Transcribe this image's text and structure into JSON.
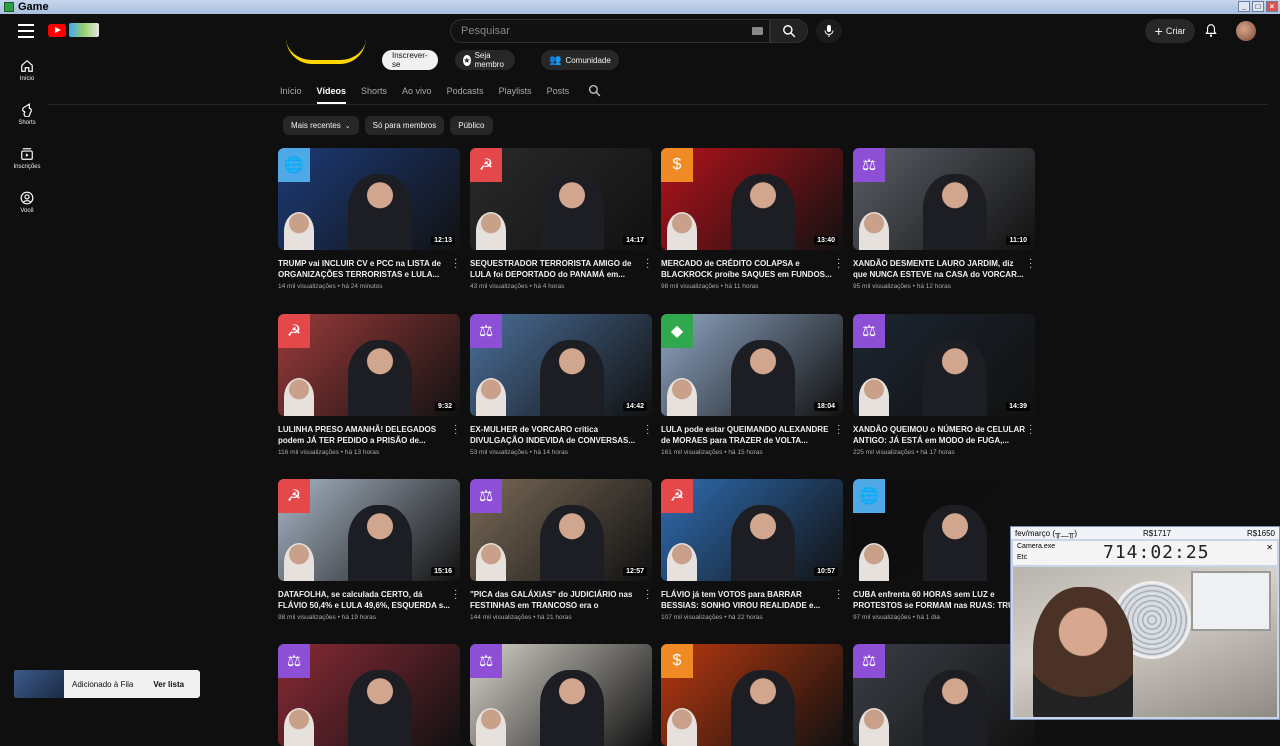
{
  "window": {
    "title": "Game"
  },
  "topbar": {
    "search_placeholder": "Pesquisar",
    "create_label": "Criar"
  },
  "sidebar": {
    "items": [
      {
        "label": "Início",
        "icon": "home-icon"
      },
      {
        "label": "Shorts",
        "icon": "shorts-icon"
      },
      {
        "label": "Inscrições",
        "icon": "subscriptions-icon"
      },
      {
        "label": "Você",
        "icon": "you-icon"
      }
    ]
  },
  "channel": {
    "subscribe_label": "Inscrever-se",
    "member_label": "Seja membro",
    "community_label": "Comunidade"
  },
  "tabs": [
    {
      "label": "Início",
      "active": false
    },
    {
      "label": "Vídeos",
      "active": true
    },
    {
      "label": "Shorts",
      "active": false
    },
    {
      "label": "Ao vivo",
      "active": false
    },
    {
      "label": "Podcasts",
      "active": false
    },
    {
      "label": "Playlists",
      "active": false
    },
    {
      "label": "Posts",
      "active": false
    }
  ],
  "chips": [
    {
      "label": "Mais recentes"
    },
    {
      "label": "Só para membros"
    },
    {
      "label": "Público"
    }
  ],
  "videos": [
    {
      "title": "TRUMP vai INCLUIR CV e PCC na LISTA de ORGANIZAÇÕES TERRORISTAS e LULA...",
      "views": "14 mil visualizações",
      "age": "há 24 minutos",
      "duration": "12:13",
      "badge": "globe",
      "badge_color": "#4fa9e6",
      "bg": "#1d3b78"
    },
    {
      "title": "SEQUESTRADOR TERRORISTA AMIGO de LULA foi DEPORTADO do PANAMÁ em...",
      "views": "43 mil visualizações",
      "age": "há 4 horas",
      "duration": "14:17",
      "badge": "hammer-sickle",
      "badge_color": "#e4484b",
      "bg": "#2a2a2a"
    },
    {
      "title": "MERCADO de CRÉDITO COLAPSA e BLACKROCK proíbe SAQUES em FUNDOS...",
      "views": "98 mil visualizações",
      "age": "há 11 horas",
      "duration": "13:40",
      "badge": "dollar",
      "badge_color": "#f08a24",
      "bg": "#b3121b"
    },
    {
      "title": "XANDÃO DESMENTE LAURO JARDIM, diz que NUNCA ESTEVE na CASA do VORCAR...",
      "views": "95 mil visualizações",
      "age": "há 12 horas",
      "duration": "11:10",
      "badge": "scales",
      "badge_color": "#8c4fd6",
      "bg": "#5a5f66"
    },
    {
      "title": "LULINHA PRESO AMANHÃ! DELEGADOS podem JÁ TER PEDIDO a PRISÃO de...",
      "views": "116 mil visualizações",
      "age": "há 13 horas",
      "duration": "9:32",
      "badge": "hammer-sickle",
      "badge_color": "#e4484b",
      "bg": "#9b3a3a"
    },
    {
      "title": "EX-MULHER de VORCARO critica DIVULGAÇÃO INDEVIDA de CONVERSAS...",
      "views": "53 mil visualizações",
      "age": "há 14 horas",
      "duration": "14:42",
      "badge": "scales",
      "badge_color": "#8c4fd6",
      "bg": "#4b6f9a"
    },
    {
      "title": "LULA pode estar QUEIMANDO ALEXANDRE de MORAES para TRAZER de VOLTA...",
      "views": "161 mil visualizações",
      "age": "há 15 horas",
      "duration": "18:04",
      "badge": "brazil-flag",
      "badge_color": "#2fa84f",
      "bg": "#8fa6c4"
    },
    {
      "title": "XANDÃO QUEIMOU o NÚMERO de CELULAR ANTIGO: JÁ ESTÁ em MODO de FUGA,...",
      "views": "225 mil visualizações",
      "age": "há 17 horas",
      "duration": "14:39",
      "badge": "scales",
      "badge_color": "#8c4fd6",
      "bg": "#1c2530"
    },
    {
      "title": "DATAFOLHA, se calculada CERTO, dá FLÁVIO 50,4% e LULA 49,6%, ESQUERDA s...",
      "views": "98 mil visualizações",
      "age": "há 19 horas",
      "duration": "15:16",
      "badge": "hammer-sickle",
      "badge_color": "#e4484b",
      "bg": "#a9b6c6"
    },
    {
      "title": "\"PICA das GALÁXIAS\" do JUDICIÁRIO nas FESTINHAS em TRANCOSO era o MORAES...",
      "views": "144 mil visualizações",
      "age": "há 21 horas",
      "duration": "12:57",
      "badge": "scales",
      "badge_color": "#8c4fd6",
      "bg": "#7a6a58"
    },
    {
      "title": "FLÁVIO já tem VOTOS para BARRAR BESSIAS: SONHO VIROU REALIDADE e...",
      "views": "107 mil visualizações",
      "age": "há 22 horas",
      "duration": "10:57",
      "badge": "hammer-sickle",
      "badge_color": "#e4484b",
      "bg": "#2f6db3"
    },
    {
      "title": "CUBA enfrenta 60 HORAS sem LUZ e PROTESTOS se FORMAM nas RUAS: TRU...",
      "views": "97 mil visualizações",
      "age": "há 1 dia",
      "duration": "",
      "badge": "globe",
      "badge_color": "#4fa9e6",
      "bg": "#0c0c0c"
    },
    {
      "title": "",
      "views": "",
      "age": "",
      "duration": "",
      "badge": "scales",
      "badge_color": "#8c4fd6",
      "bg": "#8a2a36"
    },
    {
      "title": "",
      "views": "",
      "age": "",
      "duration": "",
      "badge": "scales",
      "badge_color": "#8c4fd6",
      "bg": "#d8d4cc"
    },
    {
      "title": "",
      "views": "",
      "age": "",
      "duration": "",
      "badge": "dollar",
      "badge_color": "#f08a24",
      "bg": "#b8380f"
    },
    {
      "title": "",
      "views": "",
      "age": "",
      "duration": "",
      "badge": "scales",
      "badge_color": "#8c4fd6",
      "bg": "#3a3f46"
    }
  ],
  "toast": {
    "message": "Adicionado à Fila",
    "action": "Ver lista"
  },
  "overlay": {
    "header_left": "fev/março (╥﹏╥)",
    "header_mid": "R$1717",
    "header_right": "R$1650",
    "app_name": "Camera.exe",
    "menu": "Etc",
    "timer": "714:02:25"
  }
}
